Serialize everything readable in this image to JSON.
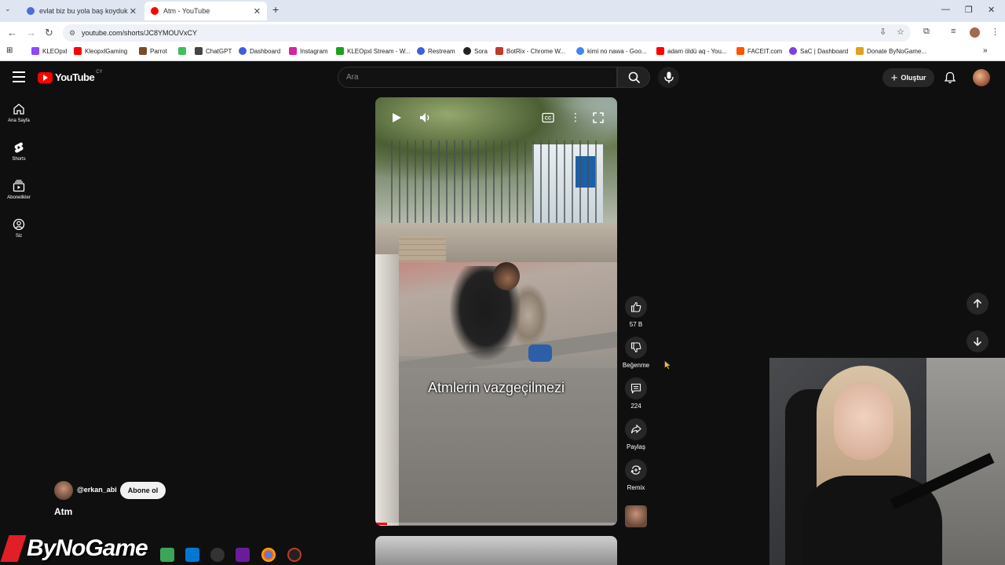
{
  "browser": {
    "tabs": [
      {
        "title": "evlat biz bu yola baş koyduk ly",
        "favicon_color": "#4a6ee0",
        "active": false
      },
      {
        "title": "Atm - YouTube",
        "favicon_color": "#ff0000",
        "active": true
      }
    ],
    "url": "youtube.com/shorts/JC8YMOUVxCY",
    "bookmarks": [
      {
        "label": "KLEOpxl",
        "color": "#9146ff"
      },
      {
        "label": "KleopxlGaming",
        "color": "#ff0000"
      },
      {
        "label": "Parrot",
        "color": "#7a4b2a"
      },
      {
        "label": "",
        "color": "#3fbf5f"
      },
      {
        "label": "ChatGPT",
        "color": "#444444"
      },
      {
        "label": "Dashboard",
        "color": "#3b5fe0"
      },
      {
        "label": "Instagram",
        "color": "#d6249f"
      },
      {
        "label": "KLEOpxl Stream - W...",
        "color": "#1aa11a"
      },
      {
        "label": "Restream",
        "color": "#3b5fe0"
      },
      {
        "label": "Sora",
        "color": "#222222"
      },
      {
        "label": "BotRix - Chrome W...",
        "color": "#c0392b"
      },
      {
        "label": "kimi no nawa - Goo...",
        "color": "#4285f4"
      },
      {
        "label": "adam öldü aq - You...",
        "color": "#ff0000"
      },
      {
        "label": "FACEIT.com",
        "color": "#ff5500"
      },
      {
        "label": "SaC | Dashboard",
        "color": "#7b3fe4"
      },
      {
        "label": "Donate ByNoGame...",
        "color": "#e0a020"
      }
    ]
  },
  "youtube": {
    "logo_text": "YouTube",
    "logo_country": "CY",
    "search_placeholder": "Ara",
    "create_label": "Oluştur",
    "sidebar": [
      {
        "label": "Ana Sayfa",
        "icon": "home-icon"
      },
      {
        "label": "Shorts",
        "icon": "shorts-icon"
      },
      {
        "label": "Abonelikler",
        "icon": "subscriptions-icon"
      },
      {
        "label": "Siz",
        "icon": "you-icon"
      }
    ],
    "video": {
      "caption": "Atmlerin vazgeçilmezi",
      "progress": 0.05
    },
    "actions": {
      "like_count": "57 B",
      "dislike_label": "Beğenme",
      "comment_count": "224",
      "share_label": "Paylaş",
      "remix_label": "Remix"
    },
    "channel": {
      "handle": "@erkan_abi",
      "subscribe_label": "Abone ol"
    },
    "title": "Atm"
  },
  "overlay": {
    "watermark": "ByNoGame"
  }
}
